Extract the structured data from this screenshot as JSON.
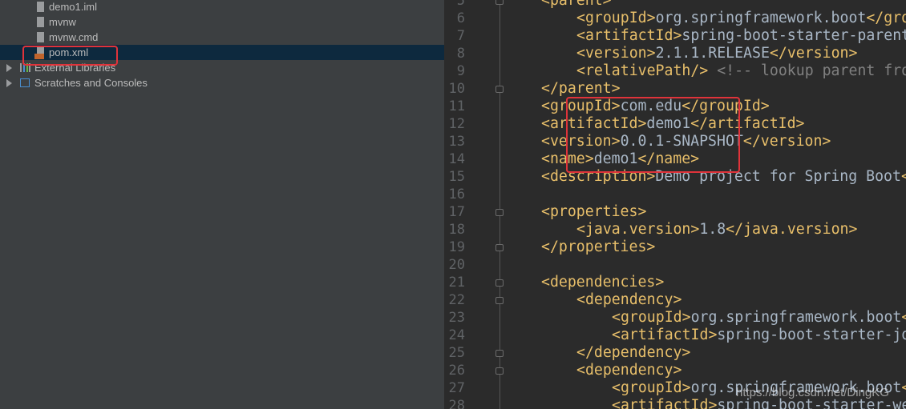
{
  "project_tree": {
    "items": [
      {
        "label": "demo1.iml",
        "icon": "iml-file-icon"
      },
      {
        "label": "mvnw",
        "icon": "text-file-icon"
      },
      {
        "label": "mvnw.cmd",
        "icon": "text-file-icon"
      },
      {
        "label": "pom.xml",
        "icon": "xml-file-icon",
        "selected": true
      },
      {
        "label": "External Libraries",
        "icon": "library-icon"
      },
      {
        "label": "Scratches and Consoles",
        "icon": "scratches-icon"
      }
    ]
  },
  "editor": {
    "lines": [
      {
        "n": "5",
        "indent": 1,
        "text": "<parent>"
      },
      {
        "n": "6",
        "indent": 2,
        "text": "<groupId>org.springframework.boot</gro"
      },
      {
        "n": "7",
        "indent": 2,
        "text": "<artifactId>spring-boot-starter-parent<"
      },
      {
        "n": "8",
        "indent": 2,
        "text": "<version>2.1.1.RELEASE</version>"
      },
      {
        "n": "9",
        "indent": 2,
        "text": "<relativePath/> <!-- lookup parent fro"
      },
      {
        "n": "10",
        "indent": 1,
        "text": "</parent>"
      },
      {
        "n": "11",
        "indent": 1,
        "text": "<groupId>com.edu</groupId>"
      },
      {
        "n": "12",
        "indent": 1,
        "text": "<artifactId>demo1</artifactId>"
      },
      {
        "n": "13",
        "indent": 1,
        "text": "<version>0.0.1-SNAPSHOT</version>"
      },
      {
        "n": "14",
        "indent": 1,
        "text": "<name>demo1</name>"
      },
      {
        "n": "15",
        "indent": 1,
        "text": "<description>Demo project for Spring Boot<"
      },
      {
        "n": "16",
        "indent": 0,
        "text": ""
      },
      {
        "n": "17",
        "indent": 1,
        "text": "<properties>"
      },
      {
        "n": "18",
        "indent": 2,
        "text": "<java.version>1.8</java.version>"
      },
      {
        "n": "19",
        "indent": 1,
        "text": "</properties>"
      },
      {
        "n": "20",
        "indent": 0,
        "text": ""
      },
      {
        "n": "21",
        "indent": 1,
        "text": "<dependencies>"
      },
      {
        "n": "22",
        "indent": 2,
        "text": "<dependency>"
      },
      {
        "n": "23",
        "indent": 3,
        "text": "<groupId>org.springframework.boot<"
      },
      {
        "n": "24",
        "indent": 3,
        "text": "<artifactId>spring-boot-starter-jd"
      },
      {
        "n": "25",
        "indent": 2,
        "text": "</dependency>"
      },
      {
        "n": "26",
        "indent": 2,
        "text": "<dependency>"
      },
      {
        "n": "27",
        "indent": 3,
        "text": "<groupId>org.springframework.boot<"
      },
      {
        "n": "28",
        "indent": 3,
        "text": "<artifactId>spring-boot-starter-we"
      }
    ],
    "fold_lines": [
      "5",
      "10",
      "17",
      "19",
      "21",
      "22",
      "25",
      "26"
    ]
  },
  "colors": {
    "tag": "#e8bf6a",
    "text": "#a9b7c6",
    "comment": "#808080",
    "highlight_box": "#e0333a"
  },
  "watermark": "https://blog.csdn.net/DingKG"
}
